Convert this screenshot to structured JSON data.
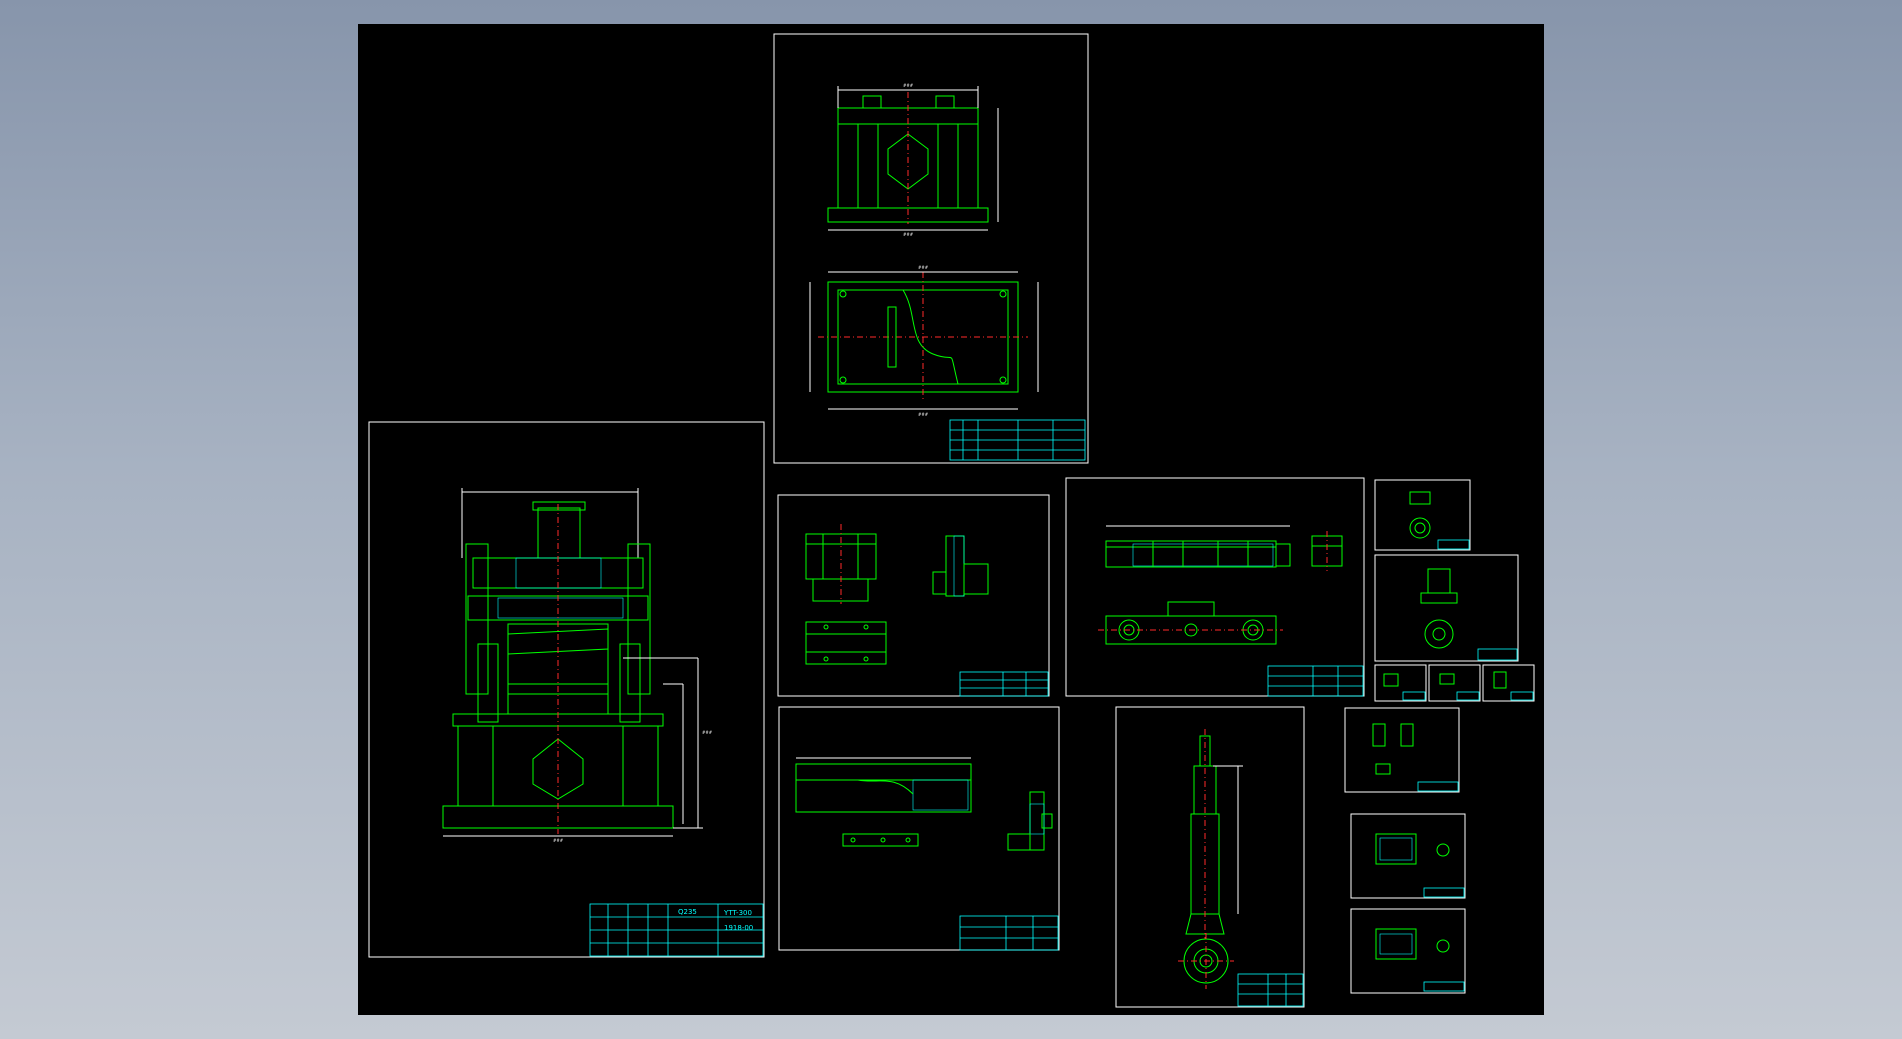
{
  "viewer": {
    "canvas_background": "#000000",
    "page_background": "#98a4b6"
  },
  "colors": {
    "outline": "#00ff00",
    "text": "#00ffff",
    "centerline": "#ff2a2a",
    "border": "#ffffff"
  },
  "drawings": [
    {
      "id": "base",
      "title_block": {
        "material": "",
        "title": "",
        "code": "",
        "scale": ""
      },
      "note": "",
      "roughness_label": ""
    },
    {
      "id": "main-assembly",
      "title_block": {
        "material": "Q235",
        "title": "",
        "code": "YTT-300",
        "scale": "1918-00"
      },
      "note": ""
    },
    {
      "id": "slider",
      "title_block": {
        "material": "",
        "title": "",
        "code": "",
        "scale": ""
      },
      "note": "",
      "roughness_label": ""
    },
    {
      "id": "upper-beam",
      "title_block": {
        "material": "",
        "title": "",
        "code": "",
        "scale": ""
      },
      "note": "",
      "roughness_label": ""
    },
    {
      "id": "lower-beam",
      "title_block": {
        "material": "",
        "title": "",
        "code": "",
        "scale": ""
      },
      "note": "",
      "roughness_label": ""
    },
    {
      "id": "column",
      "title_block": {
        "material": "",
        "title": "",
        "code": "",
        "scale": ""
      },
      "note": "",
      "roughness_label": ""
    }
  ]
}
